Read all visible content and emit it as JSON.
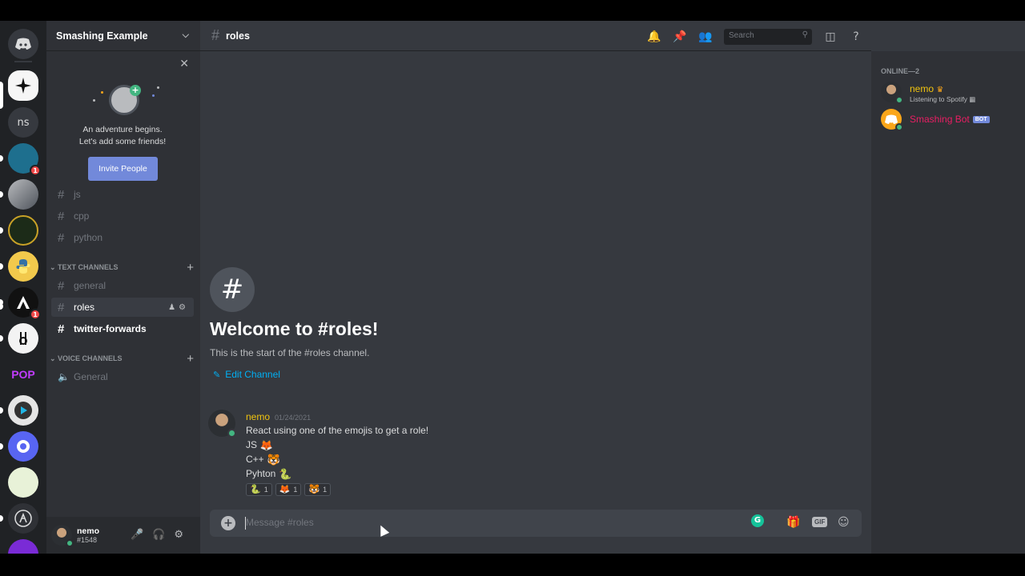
{
  "server": {
    "name": "Smashing Example",
    "servers": [
      {
        "label": "",
        "color": "#7289da",
        "glyph": "discord-logo",
        "badge": ""
      },
      {
        "label": "",
        "color": "#f6f6f6",
        "glyph": "star-logo",
        "badge": ""
      },
      {
        "label": "ns",
        "color": "#36393f",
        "glyph": "text",
        "badge": ""
      },
      {
        "label": "",
        "color": "#1e6f8e",
        "glyph": "avatar",
        "badge": "1"
      },
      {
        "label": "",
        "color": "#6a6f80",
        "glyph": "avatar",
        "badge": ""
      },
      {
        "label": "",
        "color": "#1c2b18",
        "glyph": "emblem",
        "badge": ""
      },
      {
        "label": "",
        "color": "#f2c94c",
        "glyph": "python-logo",
        "badge": ""
      },
      {
        "label": "",
        "color": "#111",
        "glyph": "a-logo",
        "badge": "1"
      },
      {
        "label": "",
        "color": "#f3f3f3",
        "glyph": "cd-logo",
        "badge": ""
      },
      {
        "label": "POP",
        "color": "#2f3136",
        "glyph": "text",
        "badge": ""
      },
      {
        "label": "",
        "color": "#e5e5e5",
        "glyph": "gear-logo",
        "badge": ""
      },
      {
        "label": "",
        "color": "#5865f2",
        "glyph": "ring-logo",
        "badge": ""
      },
      {
        "label": "",
        "color": "#e8f2d8",
        "glyph": "badge-logo",
        "badge": ""
      },
      {
        "label": "",
        "color": "#2f3136",
        "glyph": "lambda-logo",
        "badge": ""
      },
      {
        "label": "",
        "color": "#7a2bd6",
        "glyph": "t-logo",
        "badge": ""
      }
    ]
  },
  "invite": {
    "line1": "An adventure begins.",
    "line2": "Let's add some friends!",
    "button": "Invite People",
    "close": "✕"
  },
  "channels": {
    "uncategorized": [
      {
        "name": "js",
        "active": false,
        "unread": false
      },
      {
        "name": "cpp",
        "active": false,
        "unread": false
      },
      {
        "name": "python",
        "active": false,
        "unread": false
      }
    ],
    "text_category": "TEXT CHANNELS",
    "text": [
      {
        "name": "general",
        "active": false,
        "unread": false
      },
      {
        "name": "roles",
        "active": true,
        "unread": false
      },
      {
        "name": "twitter-forwards",
        "active": false,
        "unread": true
      }
    ],
    "voice_category": "VOICE CHANNELS",
    "voice": [
      {
        "name": "General"
      }
    ]
  },
  "user": {
    "name": "nemo",
    "tag": "#1548"
  },
  "topbar": {
    "channel": "roles",
    "search_placeholder": "Search"
  },
  "welcome": {
    "title": "Welcome to #roles!",
    "subtitle": "This is the start of the #roles channel.",
    "edit": "Edit Channel"
  },
  "message": {
    "author": "nemo",
    "timestamp": "01/24/2021",
    "lines": [
      {
        "text": "React using one of the emojis to get a role!",
        "emoji": ""
      },
      {
        "text": "JS",
        "emoji": "🦊"
      },
      {
        "text": "C++",
        "emoji": "🐯"
      },
      {
        "text": "Pyhton",
        "emoji": "🐍"
      }
    ],
    "reactions": [
      {
        "emoji": "🐍",
        "count": "1"
      },
      {
        "emoji": "🦊",
        "count": "1"
      },
      {
        "emoji": "🐯",
        "count": "1"
      }
    ]
  },
  "composer": {
    "placeholder": "Message #roles",
    "gif": "GIF"
  },
  "members": {
    "header": "ONLINE—2",
    "list": [
      {
        "name": "nemo",
        "color": "#f1c40f",
        "activity": "Listening to Spotify",
        "bot": ""
      },
      {
        "name": "Smashing Bot",
        "color": "#e91e63",
        "activity": "",
        "bot": "BOT"
      }
    ]
  },
  "colors": {
    "accent": "#7289da",
    "online": "#43b581",
    "link": "#00b0f4"
  }
}
